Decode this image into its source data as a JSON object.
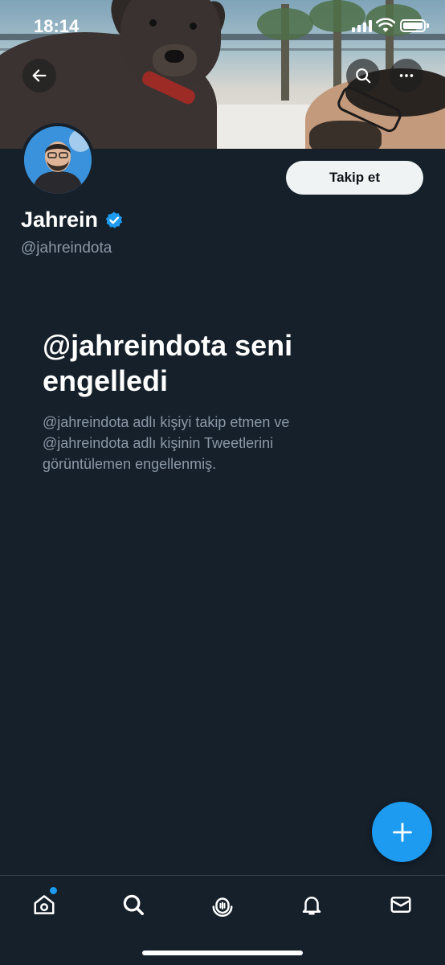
{
  "status_bar": {
    "time": "18:14"
  },
  "header": {
    "back_icon": "arrow-left-icon",
    "search_icon": "search-icon",
    "more_icon": "more-horizontal-icon"
  },
  "profile": {
    "display_name": "Jahrein",
    "verified_icon": "verified-badge-icon",
    "verified_color": "#1d9bf0",
    "handle": "@jahreindota",
    "follow_label": "Takip et"
  },
  "blocked": {
    "title": "@jahreindota seni engelledi",
    "description": "@jahreindota adlı kişiyi takip etmen ve @jahreindota adlı kişinin Tweetlerini görüntülemen engellenmiş."
  },
  "fab": {
    "icon": "plus-icon",
    "color": "#1d9bf0"
  },
  "bottom_nav": {
    "items": [
      {
        "icon": "home-icon",
        "has_notification_dot": true
      },
      {
        "icon": "search-icon"
      },
      {
        "icon": "spaces-icon"
      },
      {
        "icon": "bell-icon"
      },
      {
        "icon": "mail-icon"
      }
    ]
  },
  "colors": {
    "background": "#15202b",
    "secondary_text": "#8b98a5",
    "accent": "#1d9bf0"
  }
}
